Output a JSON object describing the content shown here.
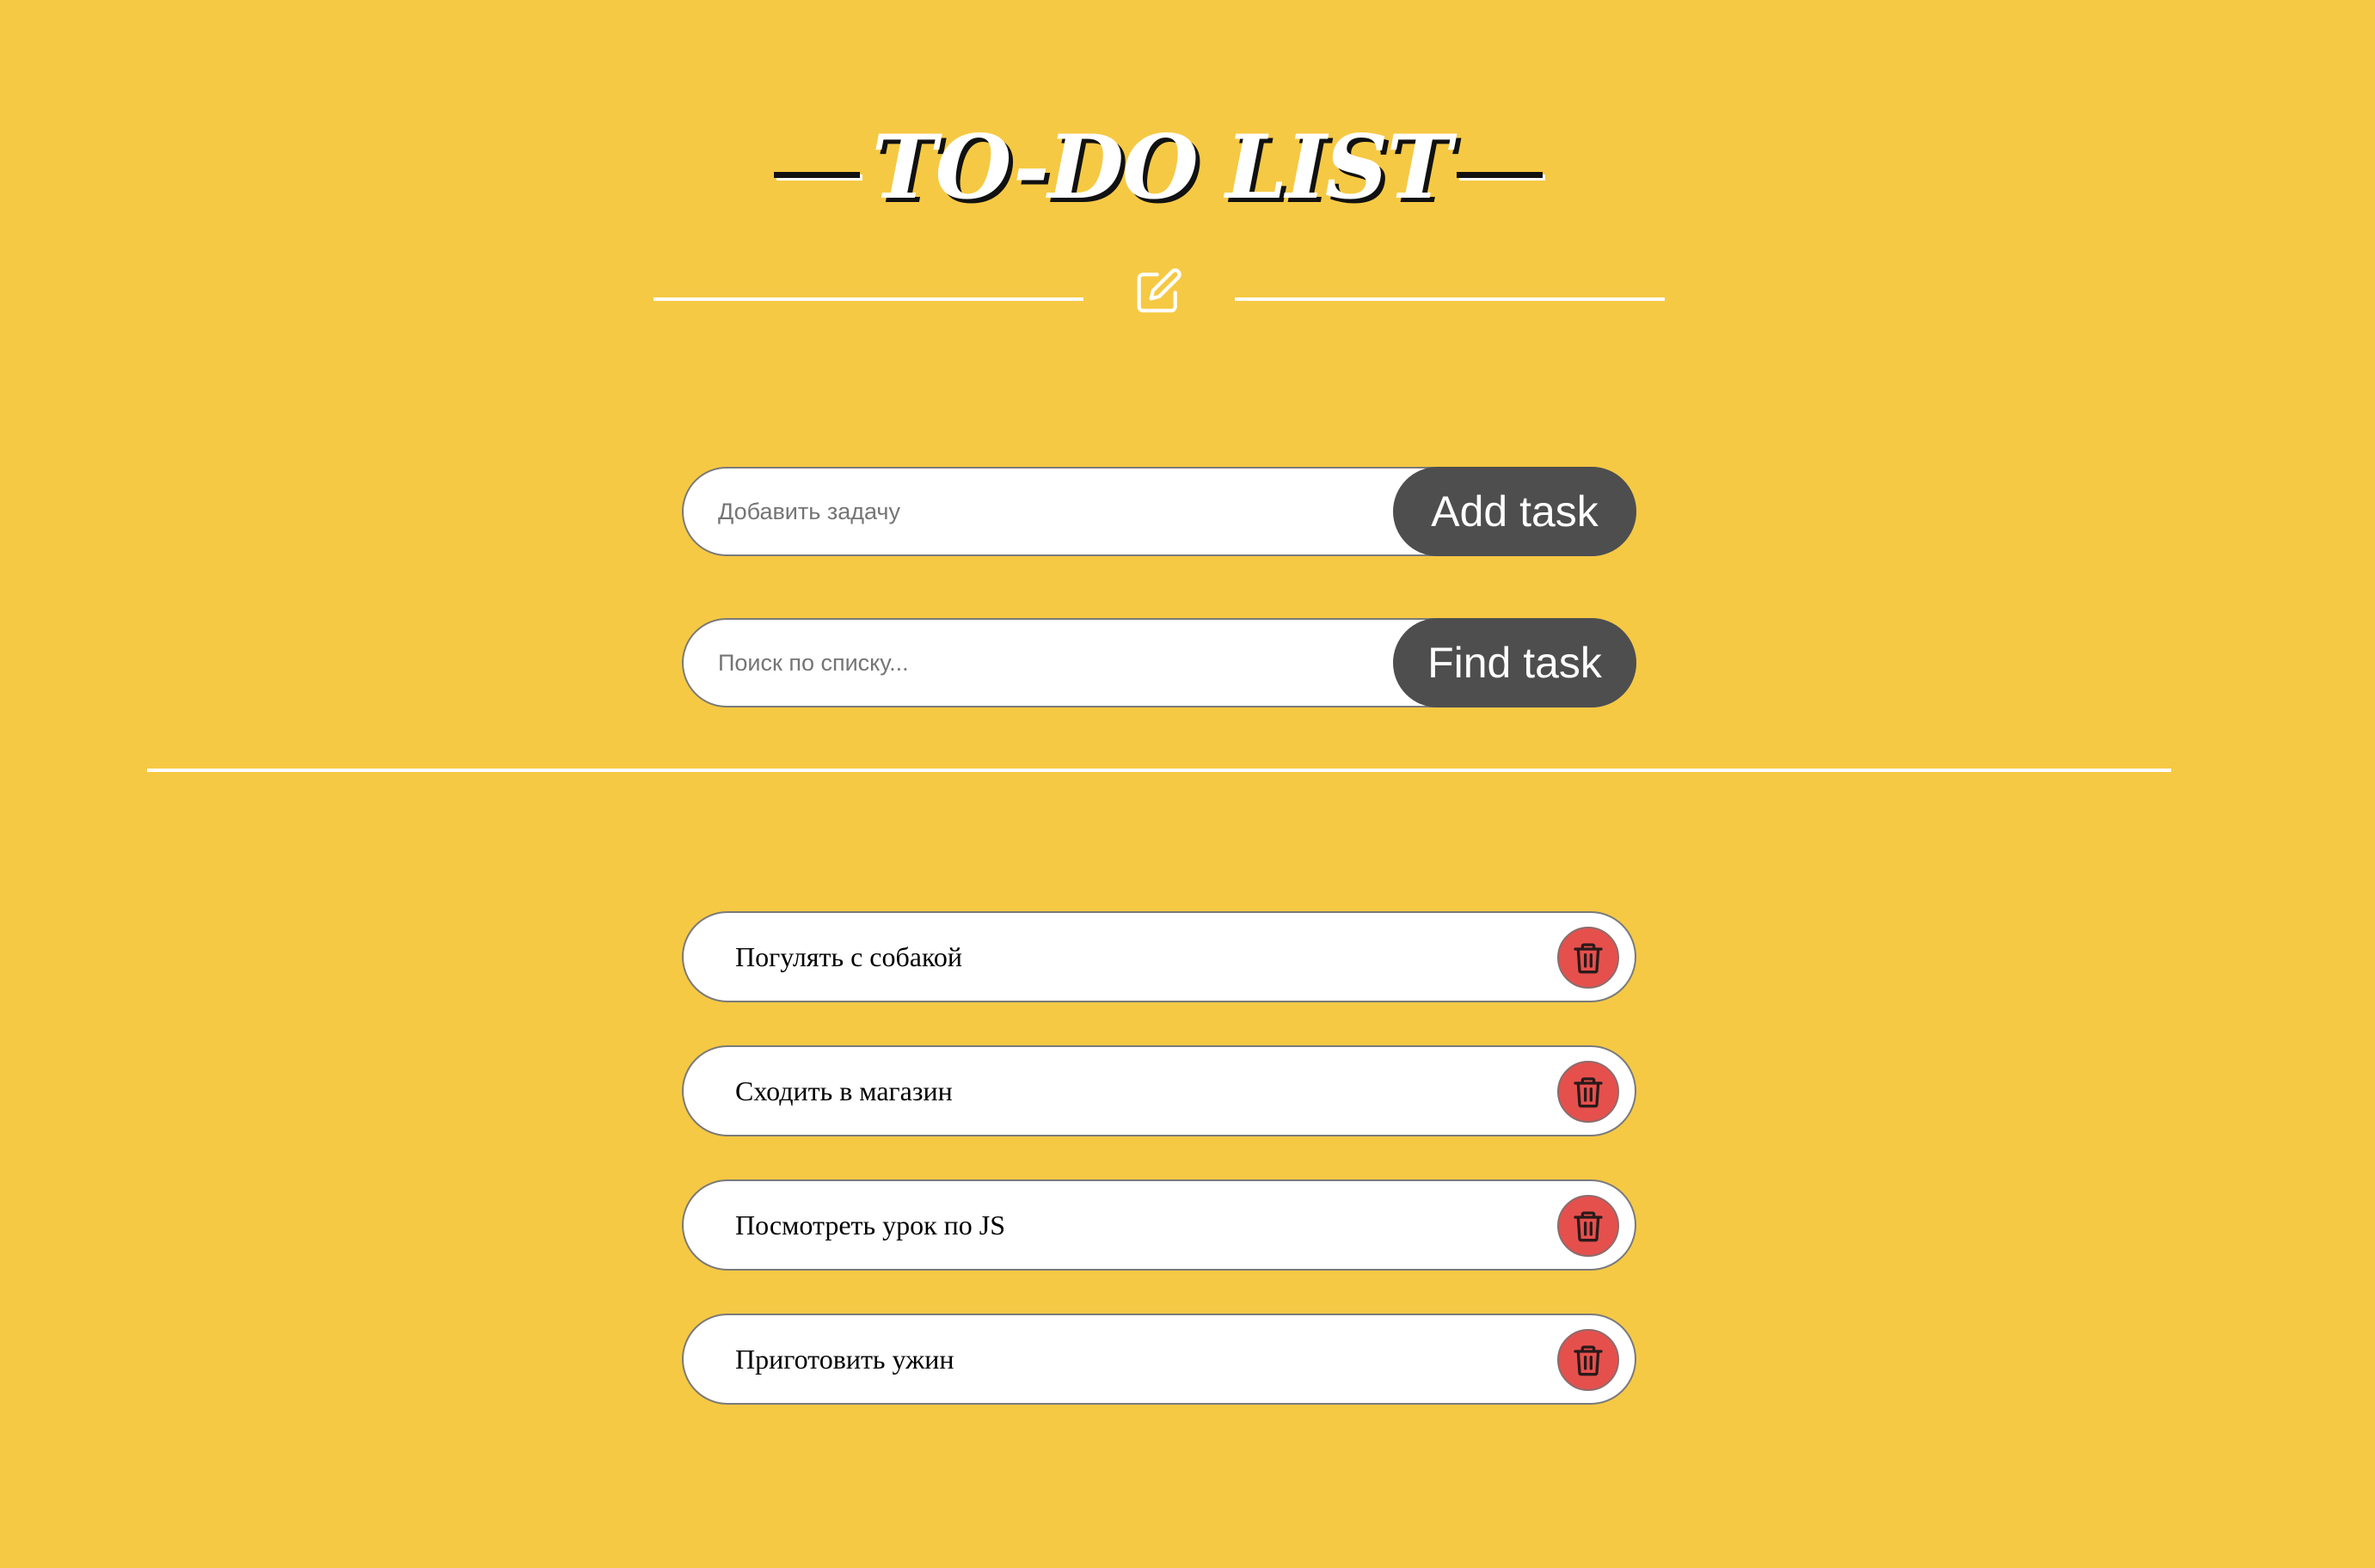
{
  "header": {
    "title": "TO-DO LIST"
  },
  "add_form": {
    "placeholder": "Добавить задачу",
    "value": "",
    "button_label": "Add task"
  },
  "search_form": {
    "placeholder": "Поиск по списку...",
    "value": "",
    "button_label": "Find task"
  },
  "tasks": [
    {
      "text": "Погулять с собакой"
    },
    {
      "text": "Сходить в магазин"
    },
    {
      "text": "Посмотреть урок по JS"
    },
    {
      "text": "Приготовить ужин"
    }
  ],
  "icons": {
    "header": "edit-icon",
    "delete": "trash-icon"
  },
  "colors": {
    "background": "#F6C944",
    "button": "#4E4E4E",
    "delete": "#E5504D",
    "divider": "#FFFFFF"
  }
}
